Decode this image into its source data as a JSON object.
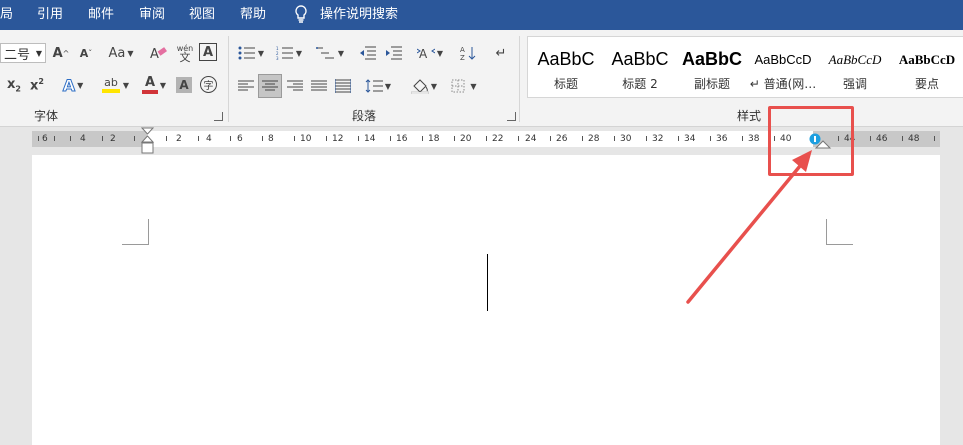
{
  "tabs": [
    "局",
    "引用",
    "邮件",
    "审阅",
    "视图",
    "帮助",
    "操作说明搜索"
  ],
  "font_group": {
    "font_size": "二号",
    "grow_font": "Aˆ",
    "shrink_font": "Aˇ",
    "change_case": "Aa",
    "clear_format": "A",
    "phonetic": "wén\n文",
    "char_border": "A",
    "subscript": "x₂",
    "superscript": "x²",
    "text_effect": "A",
    "highlight": "ab",
    "font_color": "A",
    "char_shading": "A",
    "enclose_char": "字",
    "label": "字体"
  },
  "paragraph_group": {
    "label": "段落"
  },
  "styles_group": {
    "label": "样式",
    "items": [
      {
        "sample": "AaBbC",
        "name": "标题"
      },
      {
        "sample": "AaBbC",
        "name": "标题 2"
      },
      {
        "sample": "AaBbC",
        "name": "副标题"
      },
      {
        "sample": "AaBbCcD",
        "name": "↵ 普通(网…"
      },
      {
        "sample": "AaBbCcD",
        "name": "强调"
      },
      {
        "sample": "AaBbCcD",
        "name": "要点"
      }
    ]
  },
  "ruler": {
    "labels": [
      "6",
      "4",
      "2",
      "2",
      "4",
      "6",
      "8",
      "10",
      "12",
      "14",
      "16",
      "18",
      "20",
      "22",
      "24",
      "26",
      "28",
      "30",
      "32",
      "34",
      "36",
      "38",
      "40",
      "44",
      "46",
      "48"
    ]
  },
  "colors": {
    "accent": "#2b579a",
    "annotation": "#e8504d",
    "highlight_yellow": "#ffe500",
    "font_red": "#d13438"
  }
}
